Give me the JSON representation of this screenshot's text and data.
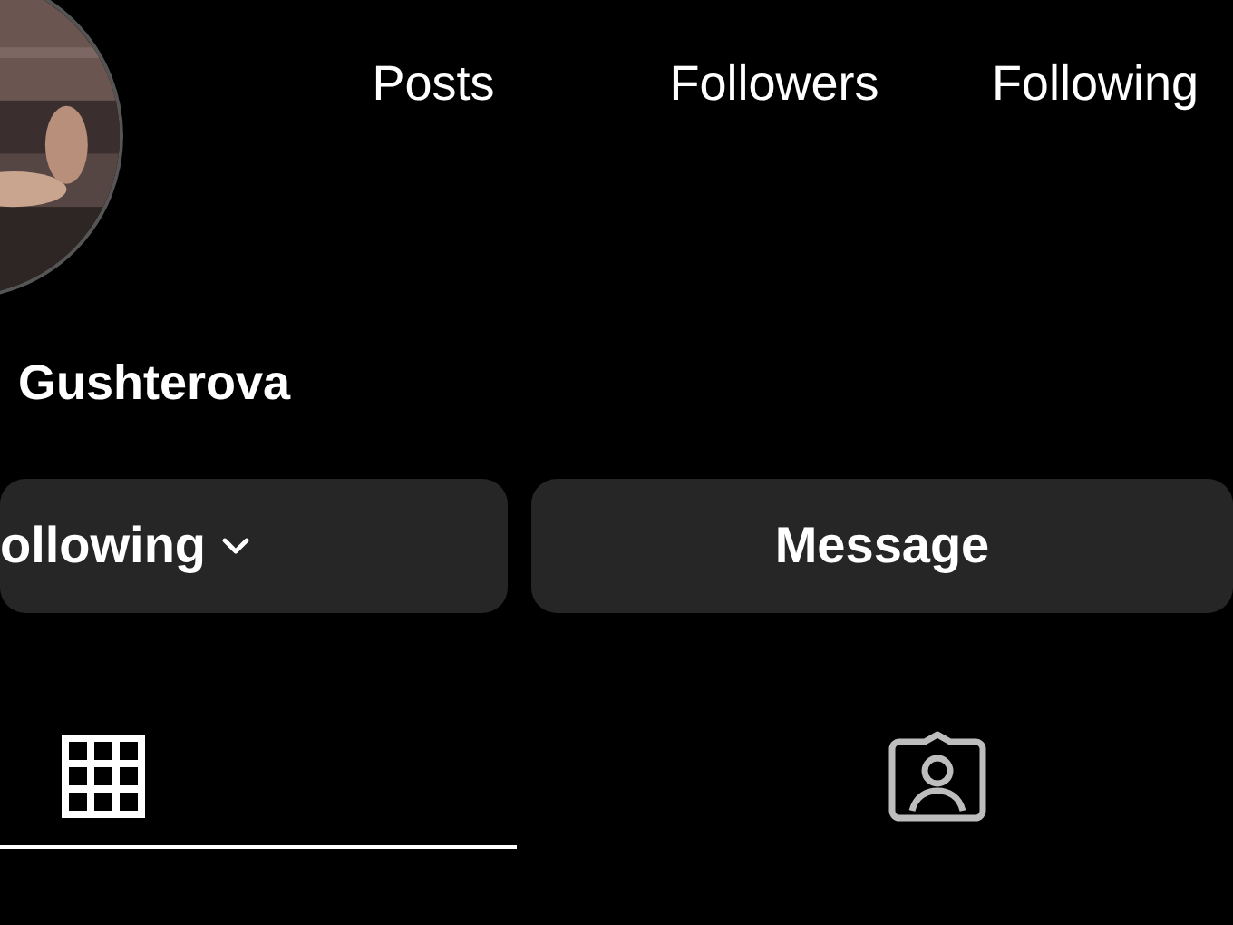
{
  "profile": {
    "name": "Gushterova"
  },
  "stats": [
    {
      "label": "Posts"
    },
    {
      "label": "Followers"
    },
    {
      "label": "Following"
    }
  ],
  "buttons": [
    {
      "label": "ollowing",
      "kind": "dropdown"
    },
    {
      "label": "Message",
      "kind": "plain"
    }
  ],
  "tabs": [
    {
      "kind": "grid",
      "selected": true
    },
    {
      "kind": "tagged",
      "selected": false
    }
  ]
}
